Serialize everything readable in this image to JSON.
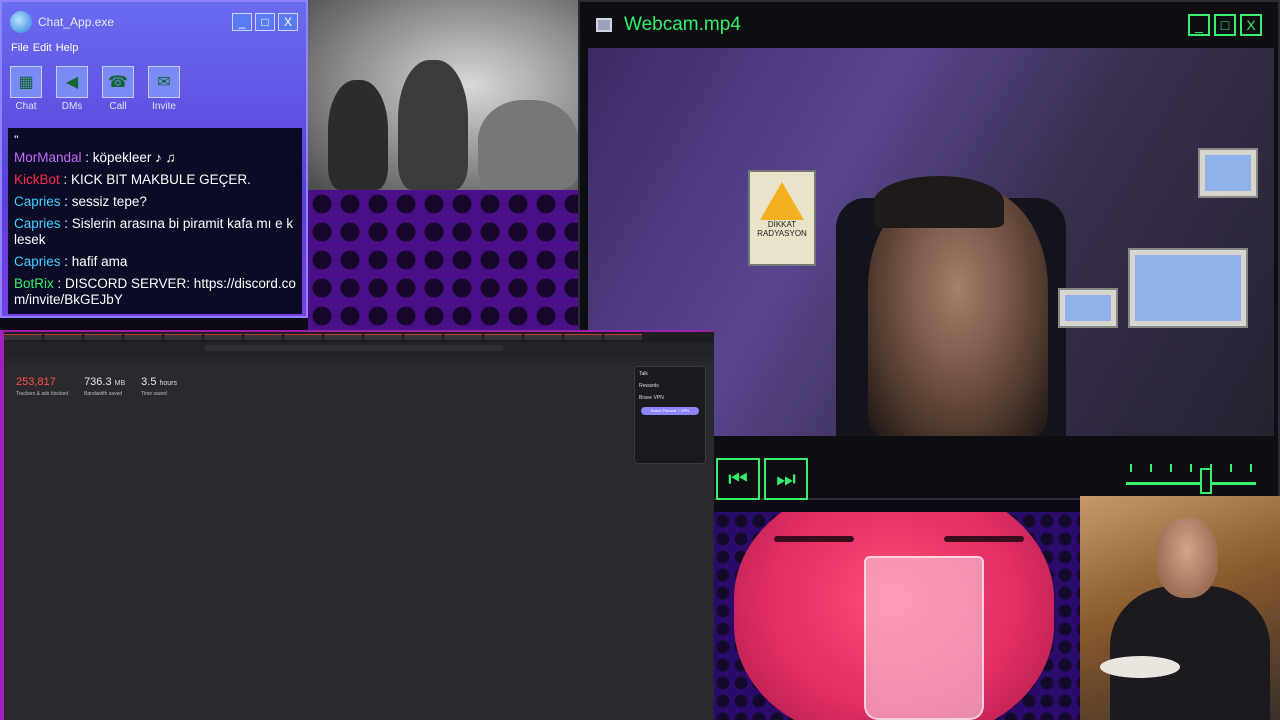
{
  "chat_window": {
    "title": "Chat_App.exe",
    "controls": {
      "minimize": "_",
      "maximize": "□",
      "close": "X"
    },
    "menu": [
      "File",
      "Edit",
      "Help"
    ],
    "tools": [
      {
        "label": "Chat",
        "icon": "chat-icon"
      },
      {
        "label": "DMs",
        "icon": "megaphone-icon"
      },
      {
        "label": "Call",
        "icon": "call-icon"
      },
      {
        "label": "Invite",
        "icon": "invite-icon"
      }
    ],
    "quote_mark": "''",
    "messages": [
      {
        "user": "MorMandal",
        "color": "#c46cff",
        "text": "köpekleer ♪ ♫"
      },
      {
        "user": "KickBot",
        "color": "#ff2a4a",
        "text": "KICK BIT MAKBULE GEÇER."
      },
      {
        "user": "Capries",
        "color": "#3fd2ff",
        "text": "sessiz tepe?"
      },
      {
        "user": "Capries",
        "color": "#3fd2ff",
        "text": "Sislerin arasına bi piramit kafa mı e klesek"
      },
      {
        "user": "Capries",
        "color": "#3fd2ff",
        "text": "hafif ama"
      },
      {
        "user": "BotRix",
        "color": "#34f06a",
        "text": "DISCORD SERVER: https://discord.com/invite/BkGEJbY"
      }
    ]
  },
  "webcam_window": {
    "title": "Webcam.mp4",
    "controls": {
      "minimize": "_",
      "maximize": "□",
      "close": "X"
    },
    "poster_line1": "DİKKAT",
    "poster_line2": "RADYASYON",
    "prev_icon": "⏮",
    "next_icon": "⏭",
    "volume_level": 0.63
  },
  "browser": {
    "stats": [
      {
        "value": "253,817",
        "unit": "",
        "label": "Trackers & ads blocked"
      },
      {
        "value": "736.3",
        "unit": "MB",
        "label": "Bandwidth saved"
      },
      {
        "value": "3.5",
        "unit": "hours",
        "label": "Time saved"
      }
    ],
    "rewards_panel": {
      "talk": "Talk",
      "rewards": "Rewards",
      "vpn": "Brave VPN",
      "cta": "Brave Firewall + VPN"
    }
  },
  "colors": {
    "accent_green": "#34f06a",
    "chat_purple": "#5a3fd8",
    "pink": "#e12d62"
  }
}
